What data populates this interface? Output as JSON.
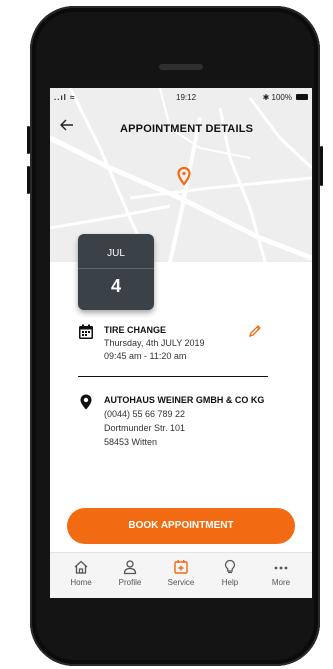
{
  "status_bar": {
    "signal": "..ıl ≈",
    "time": "19:12",
    "battery": "✱ 100%"
  },
  "header": {
    "title": "APPOINTMENT DETAILS"
  },
  "date": {
    "month": "JUL",
    "day": "4"
  },
  "appointment": {
    "service": "TIRE CHANGE",
    "date_line": "Thursday, 4th JULY 2019",
    "time_line": "09:45 am - 11:20 am"
  },
  "dealer": {
    "name": "AUTOHAUS WEINER GMBH & CO KG",
    "phone": "(0044) 55 66 789 22",
    "street": "Dortmunder Str. 101",
    "city": "58453 Witten"
  },
  "book_button": {
    "label": "BOOK APPOINTMENT"
  },
  "nav": [
    {
      "label": "Home",
      "icon": "home-icon"
    },
    {
      "label": "Profile",
      "icon": "profile-icon"
    },
    {
      "label": "Service",
      "icon": "service-icon"
    },
    {
      "label": "Help",
      "icon": "help-icon"
    },
    {
      "label": "More",
      "icon": "more-icon"
    }
  ],
  "colors": {
    "accent": "#f26a12",
    "date_card": "#3b4247"
  }
}
